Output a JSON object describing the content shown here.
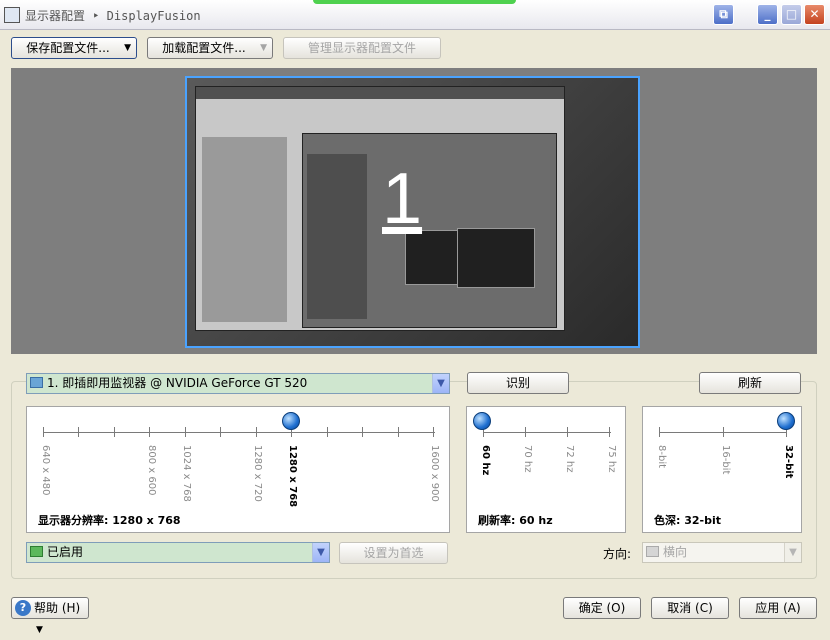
{
  "window": {
    "title": "显示器配置 ‣ DisplayFusion"
  },
  "toolbar": {
    "save_profile": "保存配置文件...",
    "load_profile": "加载配置文件...",
    "manage_profiles": "管理显示器配置文件"
  },
  "preview": {
    "monitor_number": "1"
  },
  "monitor_select": {
    "value": "1. 即插即用监视器 @ NVIDIA GeForce GT 520"
  },
  "buttons": {
    "identify": "识别",
    "refresh": "刷新",
    "set_primary": "设置为首选",
    "ok": "确定 (O)",
    "cancel": "取消 (C)",
    "apply": "应用 (A)",
    "help": "帮助 (H)"
  },
  "resolution": {
    "ticks": [
      "640 x 480",
      "800 x 600",
      "1024 x 768",
      "1280 x 720",
      "1280 x 768",
      "1600 x 900"
    ],
    "selected": "1280 x 768",
    "label": "显示器分辨率: 1280 x 768"
  },
  "refresh_rate": {
    "ticks": [
      "60 hz",
      "70 hz",
      "72 hz",
      "75 hz"
    ],
    "selected": "60 hz",
    "label": "刷新率: 60 hz"
  },
  "color_depth": {
    "ticks": [
      "8-bit",
      "16-bit",
      "32-bit"
    ],
    "selected": "32-bit",
    "label": "色深: 32-bit"
  },
  "enabled_select": {
    "value": "已启用"
  },
  "orientation": {
    "label": "方向:",
    "value": "横向"
  },
  "colors": {
    "accent": "#4aa3ff",
    "combo_bg": "#cfe6cf"
  }
}
